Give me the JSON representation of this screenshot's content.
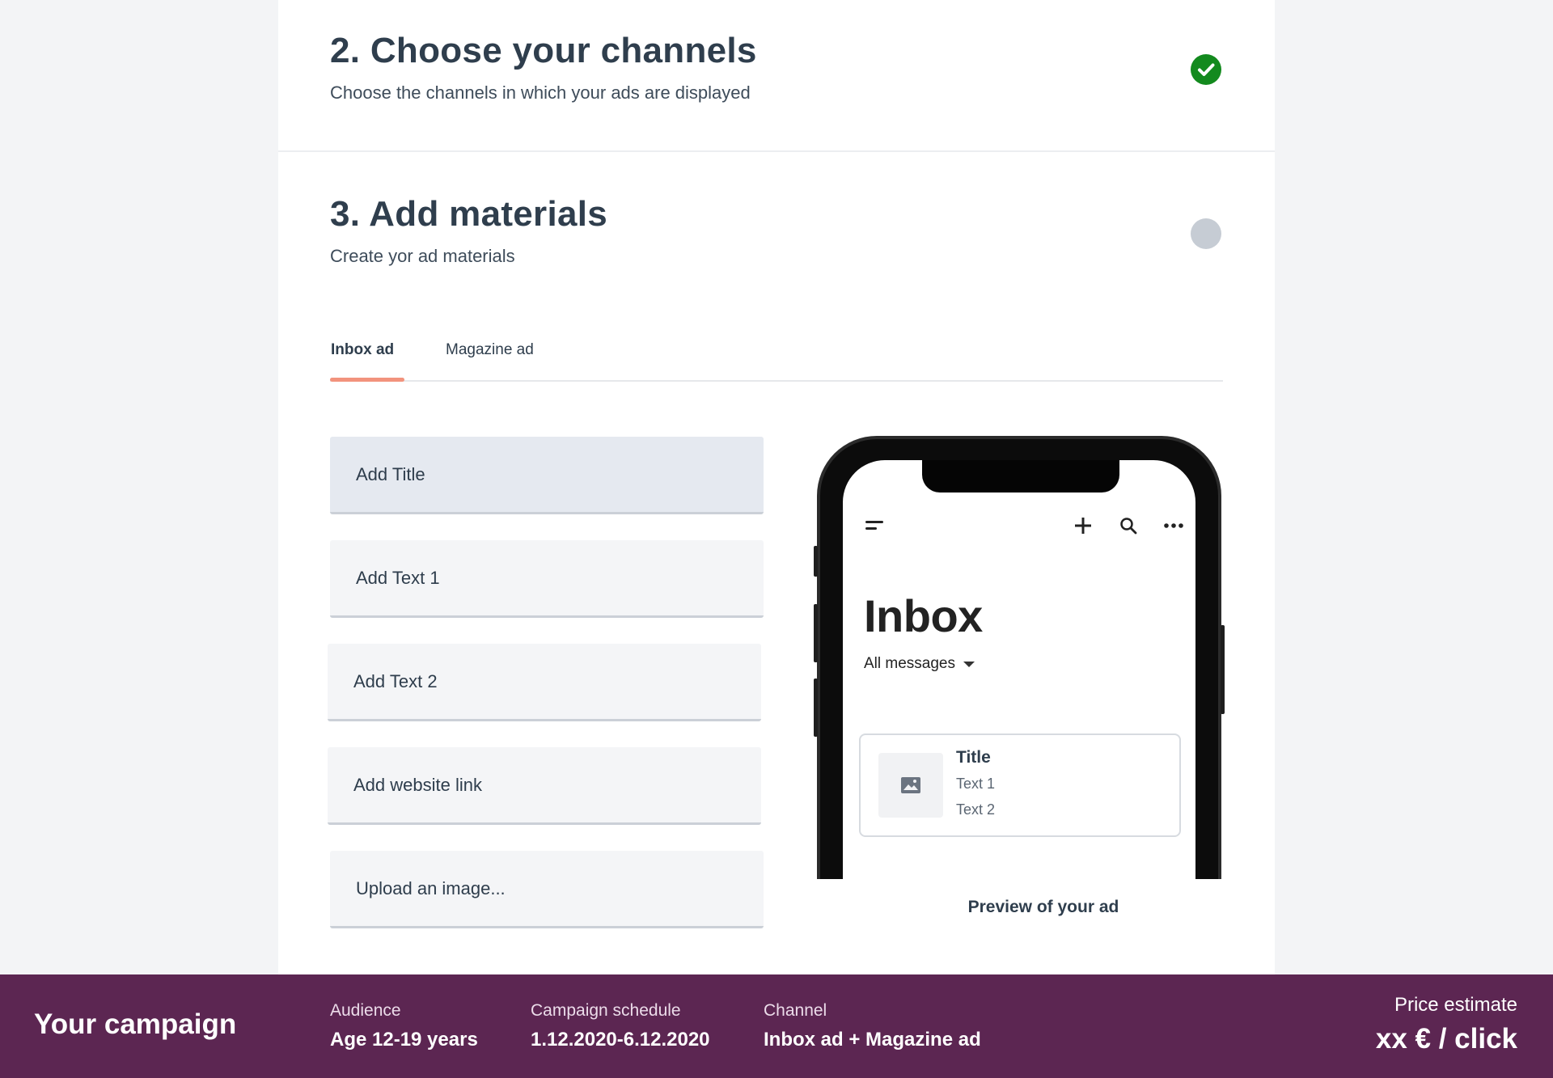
{
  "steps": [
    {
      "title": "2. Choose your channels",
      "subtitle": "Choose the channels in which your ads are displayed",
      "status": "complete"
    },
    {
      "title": "3. Add materials",
      "subtitle": "Create yor ad materials",
      "status": "pending"
    }
  ],
  "tabs": [
    {
      "label": "Inbox ad",
      "active": true
    },
    {
      "label": "Magazine ad",
      "active": false
    }
  ],
  "fields": [
    {
      "label": "Add Title"
    },
    {
      "label": "Add Text 1"
    },
    {
      "label": "Add Text 2"
    },
    {
      "label": "Add website link"
    },
    {
      "label": "Upload an image..."
    }
  ],
  "preview": {
    "inbox_title": "Inbox",
    "filter_label": "All messages",
    "icons": [
      "menu-icon",
      "plus-icon",
      "search-icon",
      "more-icon",
      "image-icon",
      "chevron-down-icon"
    ],
    "ad": {
      "title": "Title",
      "text1": "Text 1",
      "text2": "Text 2"
    },
    "caption": "Preview of your ad"
  },
  "footer": {
    "title": "Your campaign",
    "audience": {
      "label": "Audience",
      "value": "Age 12-19 years"
    },
    "schedule": {
      "label": "Campaign schedule",
      "value": "1.12.2020-6.12.2020"
    },
    "channel": {
      "label": "Channel",
      "value": "Inbox ad + Magazine ad"
    },
    "price": {
      "label": "Price estimate",
      "value": "xx € / click"
    }
  },
  "colors": {
    "footer_bg": "#5c2652",
    "accent_underline": "#f2937d",
    "complete": "#138a1e",
    "pending": "#c6ccd4"
  }
}
